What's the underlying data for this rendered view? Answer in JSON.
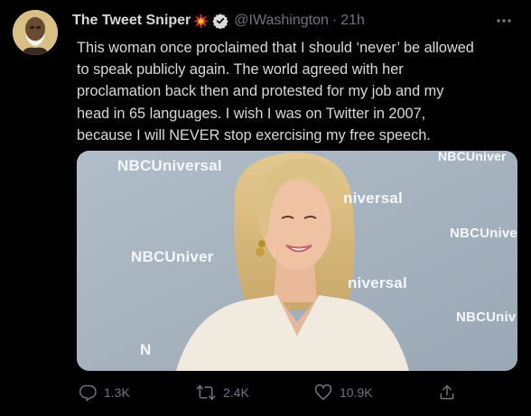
{
  "tweet": {
    "author_name": "The Tweet Sniper",
    "author_handle": "@IWashington",
    "separator": "·",
    "timestamp": "21h",
    "text_lines": [
      "This woman once proclaimed that I should ‘never’ be allowed",
      "to speak publicly again. The world agreed with her",
      "proclamation back then and protested for my job and my",
      "head in 65 languages. I wish I was on Twitter in 2007,",
      "because I will NEVER stop exercising my free speech."
    ],
    "photo": {
      "watermarks": [
        "NBCUniversal",
        "NBCUniver",
        "niversal",
        "NBCUnive",
        "niversal",
        "NBCUniv",
        "NBCUniver",
        "N"
      ]
    }
  },
  "actions": {
    "reply_count": "1.3K",
    "retweet_count": "2.4K",
    "like_count": "10.9K"
  },
  "colors": {
    "background": "#000000",
    "text": "#d9d9d9",
    "secondary": "#6e767d",
    "verified": "#d9d9d9"
  },
  "icons": [
    "collision-emoji-icon",
    "verified-badge-icon",
    "more-icon",
    "reply-icon",
    "retweet-icon",
    "like-icon",
    "share-icon"
  ]
}
